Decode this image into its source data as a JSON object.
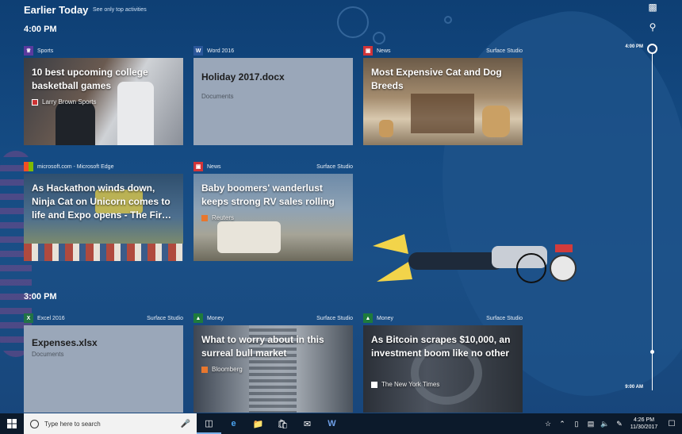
{
  "header": {
    "title": "Earlier Today",
    "link": "See only top activities"
  },
  "groups": [
    {
      "time": "4:00 PM"
    },
    {
      "time": "3:00 PM"
    }
  ],
  "timeline": {
    "top_label": "4:00 PM",
    "bottom_label": "9:00 AM"
  },
  "cards": [
    {
      "app": "Sports",
      "device": "",
      "title": "10 best upcoming college basketball games",
      "source": "Larry Brown Sports",
      "app_color": "#5b3a9e",
      "icon": "trophy-icon"
    },
    {
      "app": "Word 2016",
      "device": "",
      "title": "Holiday 2017.docx",
      "source": "Documents",
      "app_color": "#2b579a",
      "icon": "word-icon"
    },
    {
      "app": "News",
      "device": "Surface Studio",
      "title": "Most Expensive Cat and Dog Breeds",
      "source": "",
      "app_color": "#d13438",
      "icon": "news-icon"
    },
    {
      "app": "microsoft.com - Microsoft Edge",
      "device": "",
      "title": "As Hackathon winds down, Ninja Cat on Unicorn comes to life and Expo opens - The Fir…",
      "source": "",
      "app_color": "#f25022",
      "icon": "microsoft-logo-icon"
    },
    {
      "app": "News",
      "device": "Surface Studio",
      "title": "Baby boomers' wanderlust keeps strong RV sales rolling",
      "source": "Reuters",
      "app_color": "#d13438",
      "icon": "news-icon"
    },
    {
      "app": "Excel 2016",
      "device": "Surface Studio",
      "title": "Expenses.xlsx",
      "source": "Documents",
      "app_color": "#217346",
      "icon": "excel-icon"
    },
    {
      "app": "Money",
      "device": "Surface Studio",
      "title": "What to worry about in this surreal bull market",
      "source": "Bloomberg",
      "app_color": "#1e7b3c",
      "icon": "money-icon"
    },
    {
      "app": "Money",
      "device": "Surface Studio",
      "title": "As Bitcoin scrapes $10,000, an investment boom like no other",
      "source": "The New York Times",
      "app_color": "#1e7b3c",
      "icon": "money-icon"
    }
  ],
  "taskbar": {
    "search_placeholder": "Type here to search",
    "time": "4:26 PM",
    "date": "11/30/2017"
  }
}
